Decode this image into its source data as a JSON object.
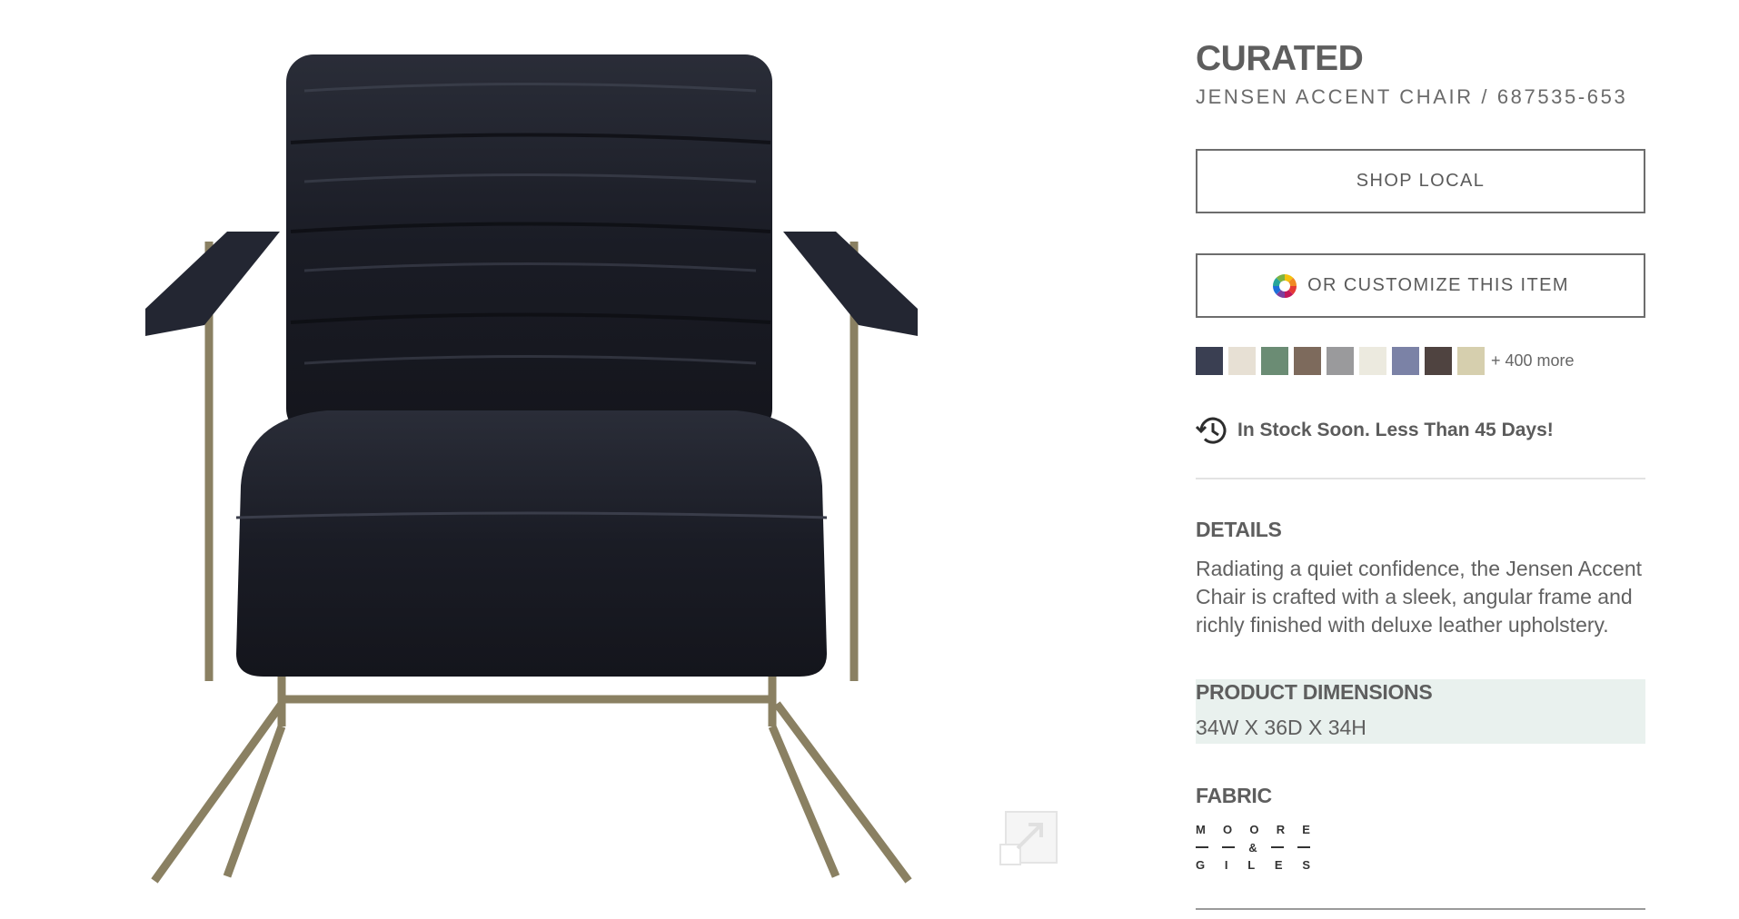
{
  "product": {
    "brand": "CURATED",
    "subtitle": "JENSEN ACCENT CHAIR / 687535-653"
  },
  "actions": {
    "shop_local_label": "SHOP LOCAL",
    "customize_label": "OR CUSTOMIZE THIS ITEM"
  },
  "swatches": {
    "colors": [
      "#3a3f52",
      "#e7e0d4",
      "#6b8c74",
      "#7d6a5c",
      "#9a9a9c",
      "#eceadf",
      "#7b82a6",
      "#4f4340",
      "#d6cfae"
    ],
    "more_label": "+ 400 more"
  },
  "availability": {
    "icon": "clock-restock-icon",
    "text": "In Stock Soon. Less Than 45 Days!"
  },
  "details": {
    "title": "DETAILS",
    "body": "Radiating a quiet confidence, the Jensen Accent Chair is crafted with a sleek, angular frame and richly finished with deluxe leather upholstery."
  },
  "dimensions": {
    "title": "PRODUCT DIMENSIONS",
    "value": "34W X 36D X 34H"
  },
  "fabric": {
    "title": "FABRIC",
    "logo_top": [
      "M",
      "O",
      "O",
      "R",
      "E"
    ],
    "logo_amp": "&",
    "logo_bottom": [
      "G",
      "I",
      "L",
      "E",
      "S"
    ]
  },
  "colors": {
    "text": "#5e5e5e",
    "dims_bg": "#e9f1ee",
    "frame": "#8a8062",
    "leather": "#1c1e26"
  }
}
